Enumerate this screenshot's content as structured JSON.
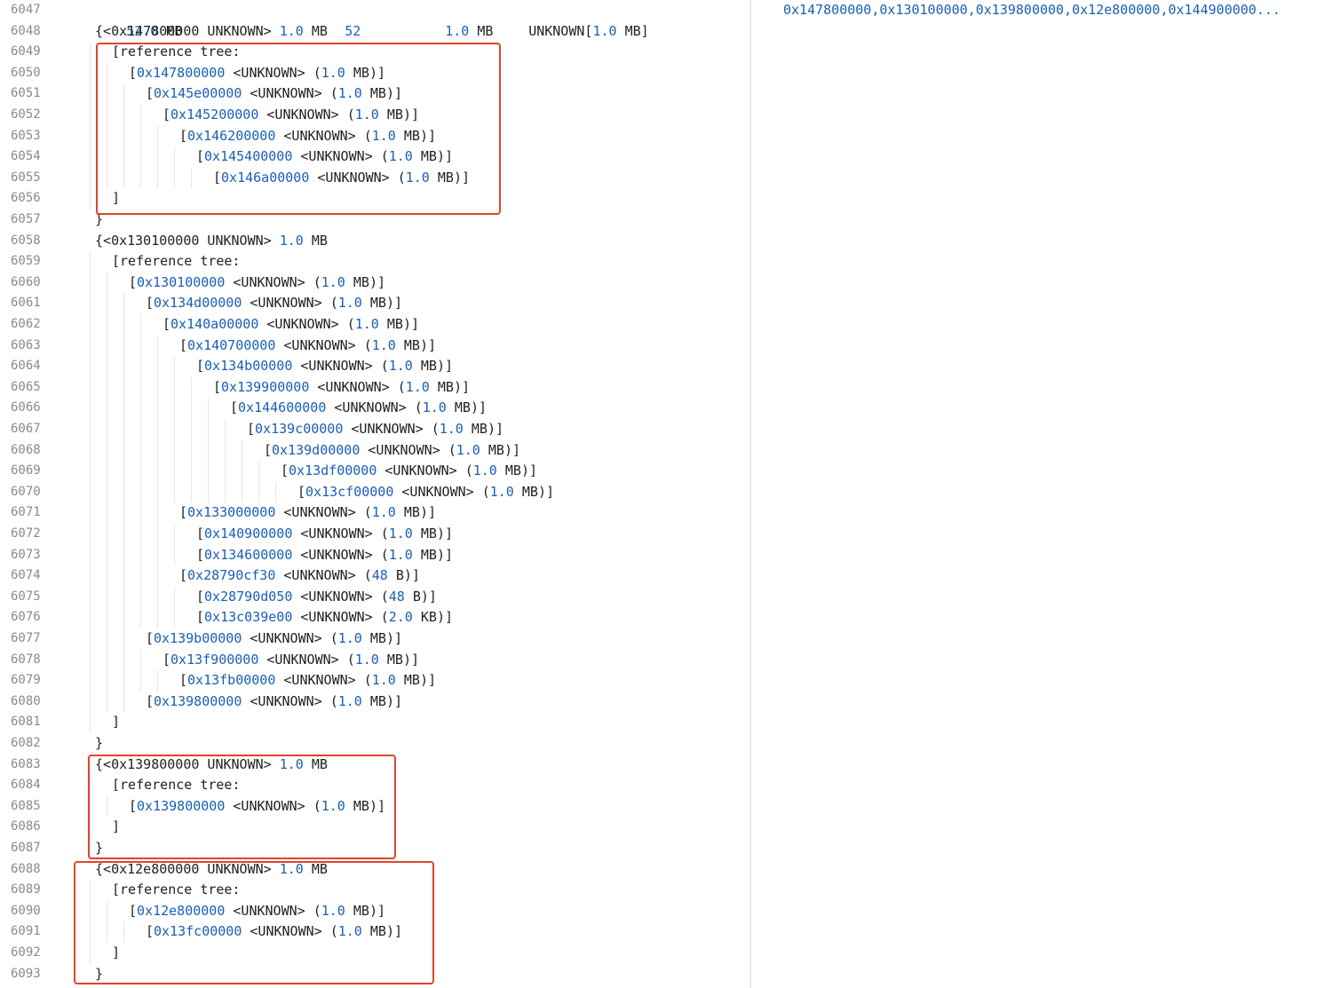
{
  "header_row": {
    "line_number": "6047",
    "total_size": "52.0",
    "total_size_unit": "MB",
    "count": "52",
    "each_size": "1.0",
    "each_unit": "MB",
    "type_text": "UNKNOWN[",
    "type_size": "1.0",
    "type_size_unit": "MB]"
  },
  "right_pane": {
    "addresses": "0x147800000,0x130100000,0x139800000,0x12e800000,0x144900000..."
  },
  "lines": [
    {
      "n": "6048",
      "indent": 1,
      "kind": "group",
      "addr": "0x147800000",
      "size": "1.0",
      "unit": "MB"
    },
    {
      "n": "6049",
      "indent": 2,
      "kind": "label",
      "text": "[reference tree:"
    },
    {
      "n": "6050",
      "indent": 3,
      "kind": "ref",
      "addr": "0x147800000",
      "size": "1.0",
      "unit": "MB"
    },
    {
      "n": "6051",
      "indent": 4,
      "kind": "ref",
      "addr": "0x145e00000",
      "size": "1.0",
      "unit": "MB"
    },
    {
      "n": "6052",
      "indent": 5,
      "kind": "ref",
      "addr": "0x145200000",
      "size": "1.0",
      "unit": "MB"
    },
    {
      "n": "6053",
      "indent": 6,
      "kind": "ref",
      "addr": "0x146200000",
      "size": "1.0",
      "unit": "MB"
    },
    {
      "n": "6054",
      "indent": 7,
      "kind": "ref",
      "addr": "0x145400000",
      "size": "1.0",
      "unit": "MB"
    },
    {
      "n": "6055",
      "indent": 8,
      "kind": "ref",
      "addr": "0x146a00000",
      "size": "1.0",
      "unit": "MB"
    },
    {
      "n": "6056",
      "indent": 2,
      "kind": "label",
      "text": "]"
    },
    {
      "n": "6057",
      "indent": 1,
      "kind": "label",
      "text": "}"
    },
    {
      "n": "6058",
      "indent": 1,
      "kind": "group",
      "addr": "0x130100000",
      "size": "1.0",
      "unit": "MB"
    },
    {
      "n": "6059",
      "indent": 2,
      "kind": "label",
      "text": "[reference tree:"
    },
    {
      "n": "6060",
      "indent": 3,
      "kind": "ref",
      "addr": "0x130100000",
      "size": "1.0",
      "unit": "MB"
    },
    {
      "n": "6061",
      "indent": 4,
      "kind": "ref",
      "addr": "0x134d00000",
      "size": "1.0",
      "unit": "MB"
    },
    {
      "n": "6062",
      "indent": 5,
      "kind": "ref",
      "addr": "0x140a00000",
      "size": "1.0",
      "unit": "MB"
    },
    {
      "n": "6063",
      "indent": 6,
      "kind": "ref",
      "addr": "0x140700000",
      "size": "1.0",
      "unit": "MB"
    },
    {
      "n": "6064",
      "indent": 7,
      "kind": "ref",
      "addr": "0x134b00000",
      "size": "1.0",
      "unit": "MB"
    },
    {
      "n": "6065",
      "indent": 8,
      "kind": "ref",
      "addr": "0x139900000",
      "size": "1.0",
      "unit": "MB"
    },
    {
      "n": "6066",
      "indent": 9,
      "kind": "ref",
      "addr": "0x144600000",
      "size": "1.0",
      "unit": "MB"
    },
    {
      "n": "6067",
      "indent": 10,
      "kind": "ref",
      "addr": "0x139c00000",
      "size": "1.0",
      "unit": "MB"
    },
    {
      "n": "6068",
      "indent": 11,
      "kind": "ref",
      "addr": "0x139d00000",
      "size": "1.0",
      "unit": "MB"
    },
    {
      "n": "6069",
      "indent": 12,
      "kind": "ref",
      "addr": "0x13df00000",
      "size": "1.0",
      "unit": "MB"
    },
    {
      "n": "6070",
      "indent": 13,
      "kind": "ref",
      "addr": "0x13cf00000",
      "size": "1.0",
      "unit": "MB"
    },
    {
      "n": "6071",
      "indent": 6,
      "kind": "ref",
      "addr": "0x133000000",
      "size": "1.0",
      "unit": "MB"
    },
    {
      "n": "6072",
      "indent": 7,
      "kind": "ref",
      "addr": "0x140900000",
      "size": "1.0",
      "unit": "MB"
    },
    {
      "n": "6073",
      "indent": 7,
      "kind": "ref",
      "addr": "0x134600000",
      "size": "1.0",
      "unit": "MB"
    },
    {
      "n": "6074",
      "indent": 6,
      "kind": "ref",
      "addr": "0x28790cf30",
      "size": "48",
      "unit": "B"
    },
    {
      "n": "6075",
      "indent": 7,
      "kind": "ref",
      "addr": "0x28790d050",
      "size": "48",
      "unit": "B"
    },
    {
      "n": "6076",
      "indent": 7,
      "kind": "ref",
      "addr": "0x13c039e00",
      "size": "2.0",
      "unit": "KB"
    },
    {
      "n": "6077",
      "indent": 4,
      "kind": "ref",
      "addr": "0x139b00000",
      "size": "1.0",
      "unit": "MB"
    },
    {
      "n": "6078",
      "indent": 5,
      "kind": "ref",
      "addr": "0x13f900000",
      "size": "1.0",
      "unit": "MB"
    },
    {
      "n": "6079",
      "indent": 6,
      "kind": "ref",
      "addr": "0x13fb00000",
      "size": "1.0",
      "unit": "MB"
    },
    {
      "n": "6080",
      "indent": 4,
      "kind": "ref",
      "addr": "0x139800000",
      "size": "1.0",
      "unit": "MB"
    },
    {
      "n": "6081",
      "indent": 2,
      "kind": "label",
      "text": "]"
    },
    {
      "n": "6082",
      "indent": 1,
      "kind": "label",
      "text": "}"
    },
    {
      "n": "6083",
      "indent": 1,
      "kind": "group",
      "addr": "0x139800000",
      "size": "1.0",
      "unit": "MB"
    },
    {
      "n": "6084",
      "indent": 2,
      "kind": "label",
      "text": "[reference tree:"
    },
    {
      "n": "6085",
      "indent": 3,
      "kind": "ref",
      "addr": "0x139800000",
      "size": "1.0",
      "unit": "MB"
    },
    {
      "n": "6086",
      "indent": 2,
      "kind": "label",
      "text": "]"
    },
    {
      "n": "6087",
      "indent": 1,
      "kind": "label",
      "text": "}"
    },
    {
      "n": "6088",
      "indent": 1,
      "kind": "group",
      "addr": "0x12e800000",
      "size": "1.0",
      "unit": "MB"
    },
    {
      "n": "6089",
      "indent": 2,
      "kind": "label",
      "text": "[reference tree:"
    },
    {
      "n": "6090",
      "indent": 3,
      "kind": "ref",
      "addr": "0x12e800000",
      "size": "1.0",
      "unit": "MB"
    },
    {
      "n": "6091",
      "indent": 4,
      "kind": "ref",
      "addr": "0x13fc00000",
      "size": "1.0",
      "unit": "MB"
    },
    {
      "n": "6092",
      "indent": 2,
      "kind": "label",
      "text": "]"
    },
    {
      "n": "6093",
      "indent": 1,
      "kind": "label",
      "text": "}"
    }
  ],
  "tokens": {
    "group_prefix": "{<",
    "group_type": " UNKNOWN> ",
    "ref_open": "[",
    "ref_type": " <UNKNOWN> (",
    "ref_close": ")]"
  },
  "colors": {
    "number": "#1a5fb4",
    "highlight_border": "#e0442f",
    "line_number": "#8a8a8a"
  }
}
